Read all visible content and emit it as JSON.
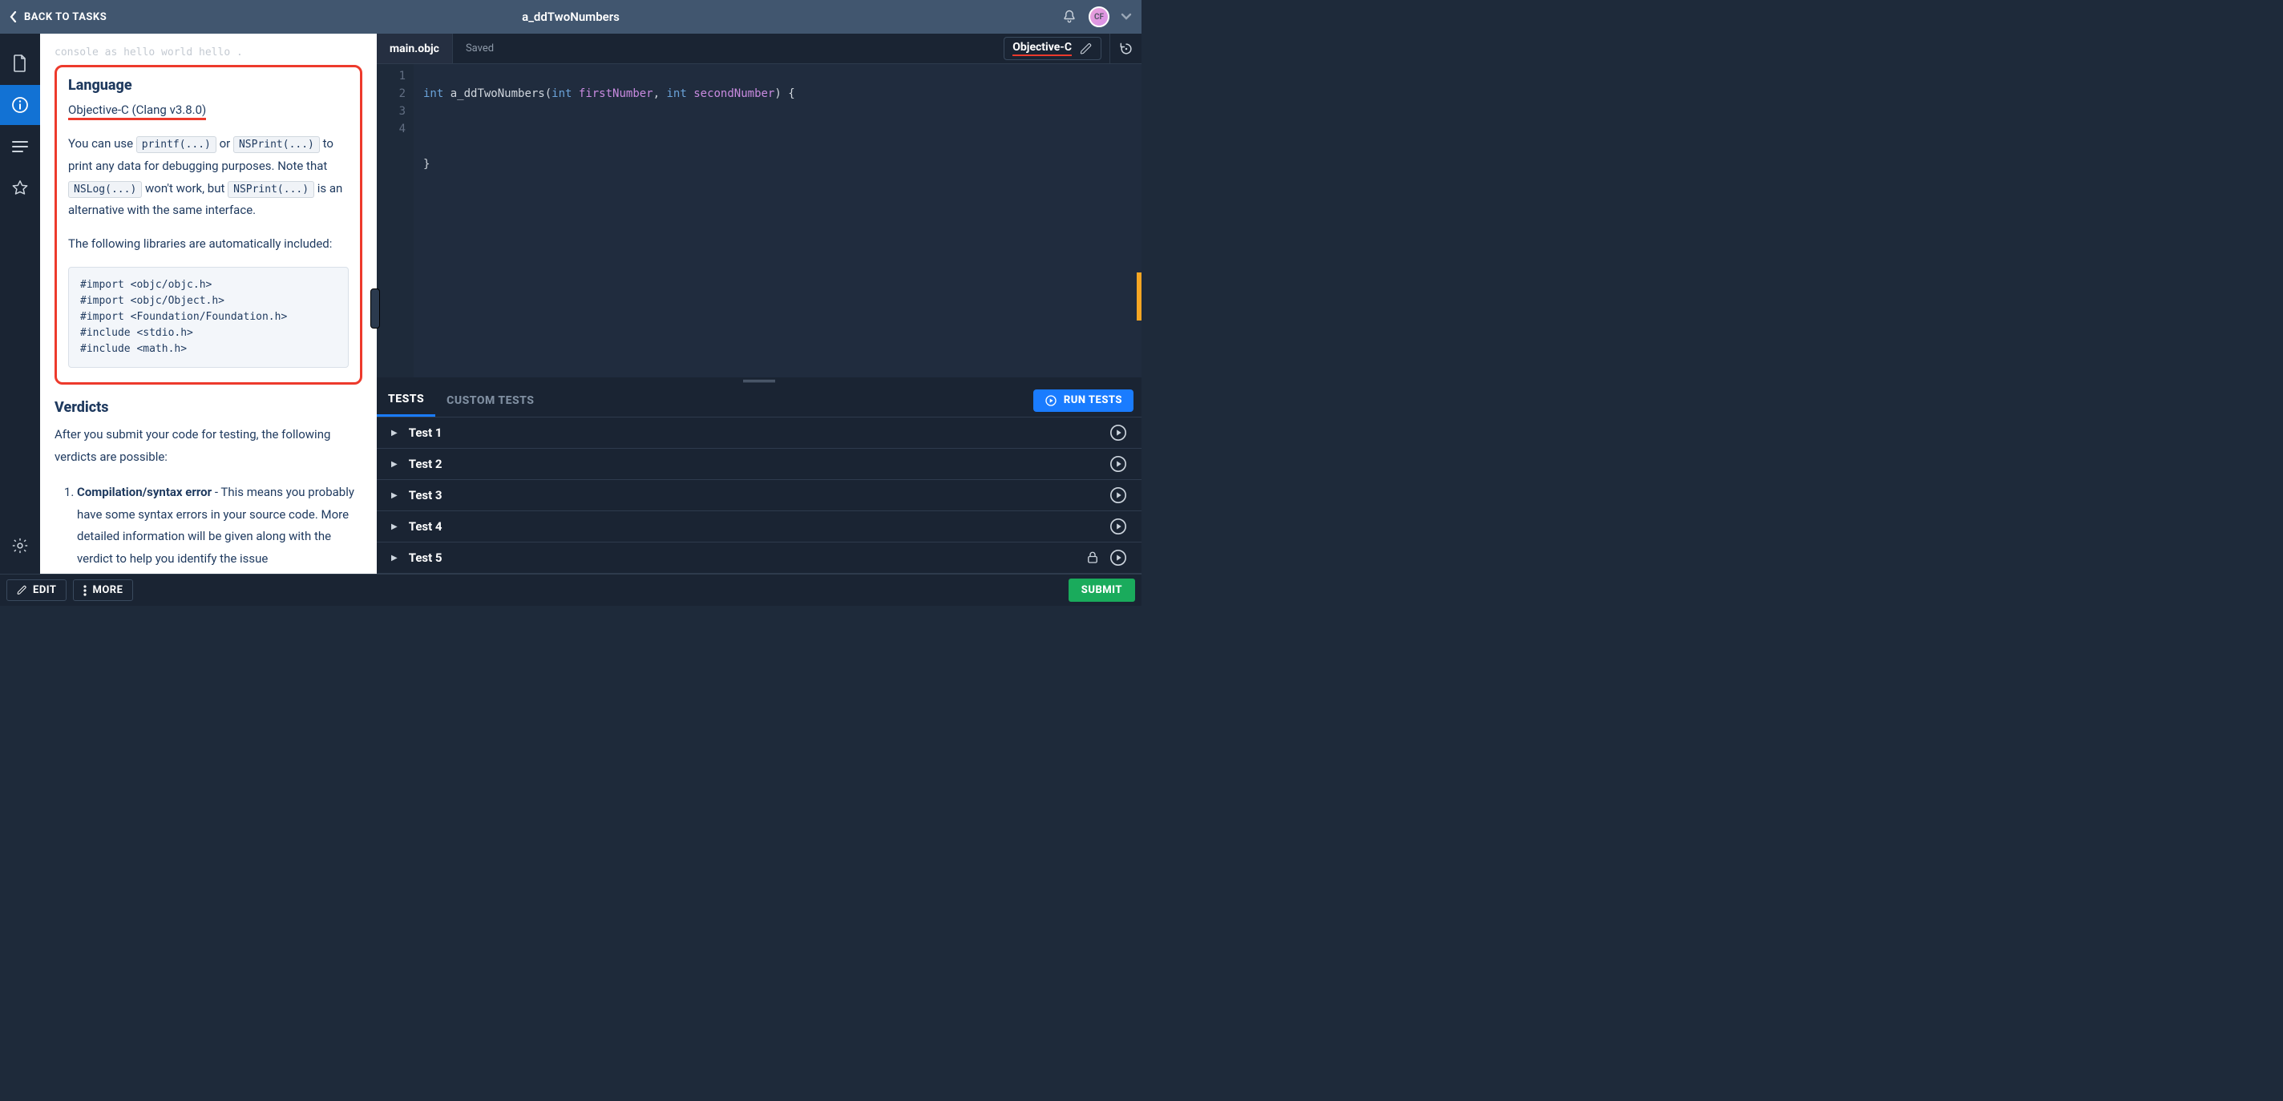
{
  "header": {
    "back_label": "BACK TO TASKS",
    "title": "a_ddTwoNumbers",
    "avatar_initials": "CF"
  },
  "description": {
    "top_fragment": "console as  hello world hello  .",
    "language": {
      "heading": "Language",
      "version": "Objective-C (Clang v3.8.0)",
      "para1_a": "You can use ",
      "printf_code": "printf(...)",
      "para1_or": " or ",
      "nsprint_code": "NSPrint(...)",
      "para1_b": " to print any data for debugging purposes. Note that ",
      "nslog_code": "NSLog(...)",
      "para1_c": " won't work, but ",
      "nsprint_code2": "NSPrint(...)",
      "para1_d": " is an alternative with the same interface.",
      "para2": "The following libraries are automatically included:",
      "code_block": "#import <objc/objc.h>\n#import <objc/Object.h>\n#import <Foundation/Foundation.h>\n#include <stdio.h>\n#include <math.h>"
    },
    "verdicts": {
      "heading": "Verdicts",
      "intro": "After you submit your code for testing, the following verdicts are possible:",
      "item1_strong": "Compilation/syntax error",
      "item1_rest": " - This means you probably have some syntax errors in your source code. More detailed information will be given along with the verdict to help you identify the issue"
    }
  },
  "editor": {
    "file_name": "main.objc",
    "status": "Saved",
    "language_label": "Objective-C",
    "lines": [
      "1",
      "2",
      "3",
      "4"
    ],
    "code": {
      "l1_int": "int",
      "l1_fn": " a_ddTwoNumbers",
      "l1_open": "(",
      "l1_int2": "int",
      "l1_p1": " firstNumber",
      "l1_comma": ", ",
      "l1_int3": "int",
      "l1_p2": " secondNumber",
      "l1_close": ") {",
      "l3": "}"
    }
  },
  "tests": {
    "tab_tests": "TESTS",
    "tab_custom": "CUSTOM TESTS",
    "run_label": "RUN TESTS",
    "rows": [
      {
        "label": "Test 1",
        "locked": false
      },
      {
        "label": "Test 2",
        "locked": false
      },
      {
        "label": "Test 3",
        "locked": false
      },
      {
        "label": "Test 4",
        "locked": false
      },
      {
        "label": "Test 5",
        "locked": true
      }
    ]
  },
  "bottom": {
    "edit": "EDIT",
    "more": "MORE",
    "submit": "SUBMIT"
  }
}
